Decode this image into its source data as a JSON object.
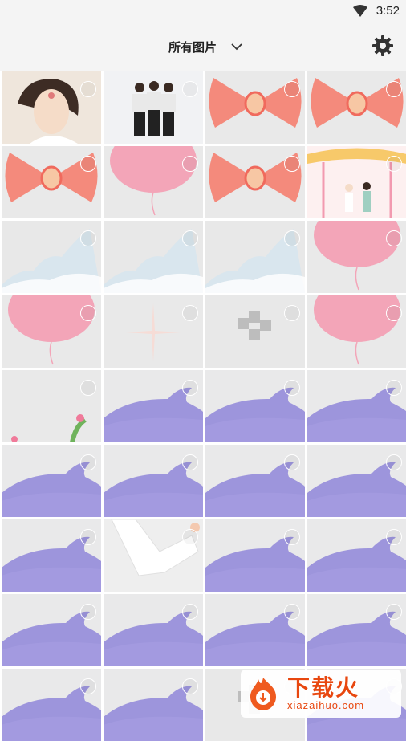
{
  "status_bar": {
    "time": "3:52",
    "wifi_icon": "wifi-icon"
  },
  "header": {
    "album_title": "所有图片",
    "dropdown_icon": "chevron-down-icon",
    "settings_icon": "gear-icon"
  },
  "colors": {
    "accent_watermark": "#e8470f",
    "bar_bg": "#f4f4f4"
  },
  "grid": {
    "tiles": [
      "portrait",
      "people",
      "bow",
      "bow",
      "bow",
      "balloon",
      "bow",
      "wedding",
      "cloud",
      "cloud",
      "cloud",
      "balloon",
      "balloon",
      "star",
      "blur",
      "balloon",
      "flowers",
      "whale",
      "whale",
      "whale",
      "whale",
      "whale",
      "whale",
      "whale",
      "whale",
      "arm",
      "whale",
      "whale",
      "whale",
      "whale",
      "whale",
      "whale",
      "whale",
      "whale",
      "blur",
      "whale"
    ]
  },
  "watermark": {
    "brand": "下载火",
    "url": "xiazaihuo.com"
  }
}
